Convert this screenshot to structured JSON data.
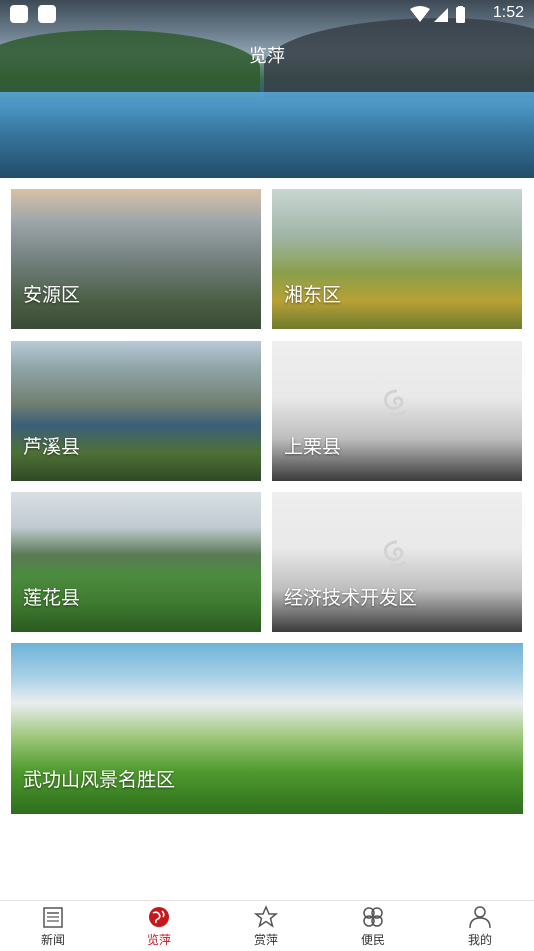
{
  "status": {
    "time": "1:52"
  },
  "header": {
    "title": "览萍"
  },
  "tiles": [
    {
      "label": "安源区"
    },
    {
      "label": "湘东区"
    },
    {
      "label": "芦溪县"
    },
    {
      "label": "上栗县"
    },
    {
      "label": "莲花县"
    },
    {
      "label": "经济技术开发区"
    },
    {
      "label": "武功山风景名胜区"
    }
  ],
  "nav": [
    {
      "label": "新闻",
      "icon": "newspaper-icon"
    },
    {
      "label": "览萍",
      "icon": "globe-icon",
      "active": true
    },
    {
      "label": "赏萍",
      "icon": "star-icon"
    },
    {
      "label": "便民",
      "icon": "clover-icon"
    },
    {
      "label": "我的",
      "icon": "person-icon"
    }
  ],
  "colors": {
    "active": "#c8161d",
    "text": "#333333"
  }
}
